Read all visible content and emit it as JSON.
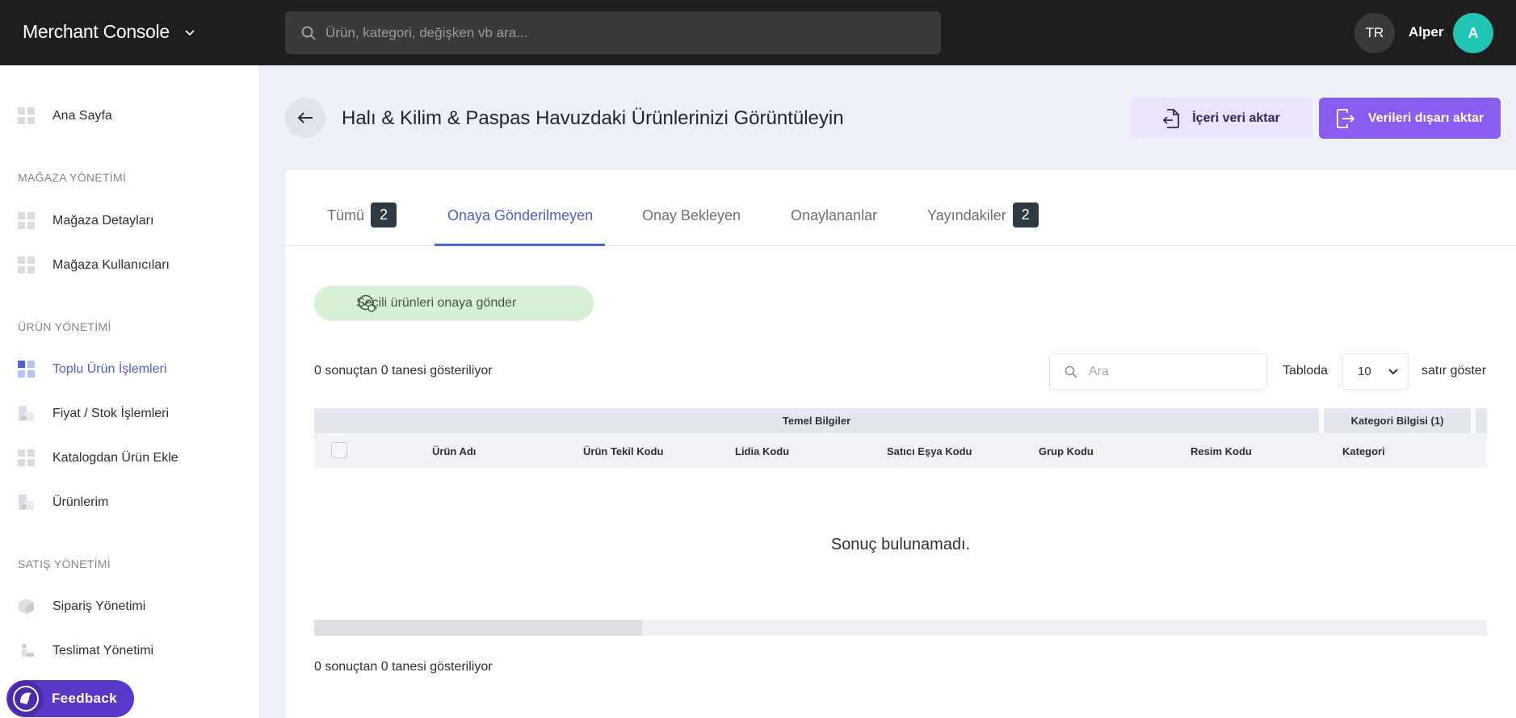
{
  "header": {
    "app_title": "Merchant Console",
    "search_placeholder": "Ürün, kategori, değişken vb ara...",
    "language": "TR",
    "user_name": "Alper",
    "avatar_initial": "A"
  },
  "sidebar": {
    "home": "Ana Sayfa",
    "sections": [
      {
        "title": "MAĞAZA YÖNETİMİ",
        "items": [
          "Mağaza Detayları",
          "Mağaza Kullanıcıları"
        ]
      },
      {
        "title": "ÜRÜN YÖNETİMİ",
        "items": [
          "Toplu Ürün İşlemleri",
          "Fiyat / Stok İşlemleri",
          "Katalogdan Ürün Ekle",
          "Ürünlerim"
        ]
      },
      {
        "title": "SATIŞ YÖNETİMİ",
        "items": [
          "Sipariş Yönetimi",
          "Teslimat Yönetimi"
        ]
      }
    ],
    "active_item": "Toplu Ürün İşlemleri"
  },
  "feedback": {
    "label": "Feedback"
  },
  "page": {
    "title": "Halı & Kilim & Paspas Havuzdaki Ürünlerinizi Görüntüleyin",
    "import_label": "İçeri veri aktar",
    "export_label": "Verileri dışarı aktar"
  },
  "tabs": [
    {
      "label": "Tümü",
      "count": "2"
    },
    {
      "label": "Onaya Gönderilmeyen",
      "active": true
    },
    {
      "label": "Onay Bekleyen"
    },
    {
      "label": "Onaylananlar"
    },
    {
      "label": "Yayındakiler",
      "count": "2"
    }
  ],
  "content": {
    "send_button": "Seçili ürünleri onaya gönder",
    "result_top": "0 sonuçtan 0 tanesi gösteriliyor",
    "result_bottom": "0 sonuçtan 0 tanesi gösteriliyor",
    "table_search_placeholder": "Ara",
    "rows_label_before": "Tabloda",
    "rows_value": "10",
    "rows_label_after": "satır göster",
    "no_result": "Sonuç bulunamadı."
  },
  "table": {
    "groups": [
      "Temel Bilgiler",
      "Kategori Bilgisi (1)"
    ],
    "columns": [
      "Ürün Adı",
      "Ürün Tekil Kodu",
      "Lidia Kodu",
      "Satıcı Eşya Kodu",
      "Grup Kodu",
      "Resim Kodu",
      "Kategori"
    ],
    "rows": []
  },
  "colors": {
    "accent": "#4a63dd",
    "export_button": "#8b5cf0",
    "import_button": "#ebe2fb",
    "send_button": "#d8f1d6",
    "avatar": "#22c4b6",
    "topbar": "#1e1e1e"
  }
}
